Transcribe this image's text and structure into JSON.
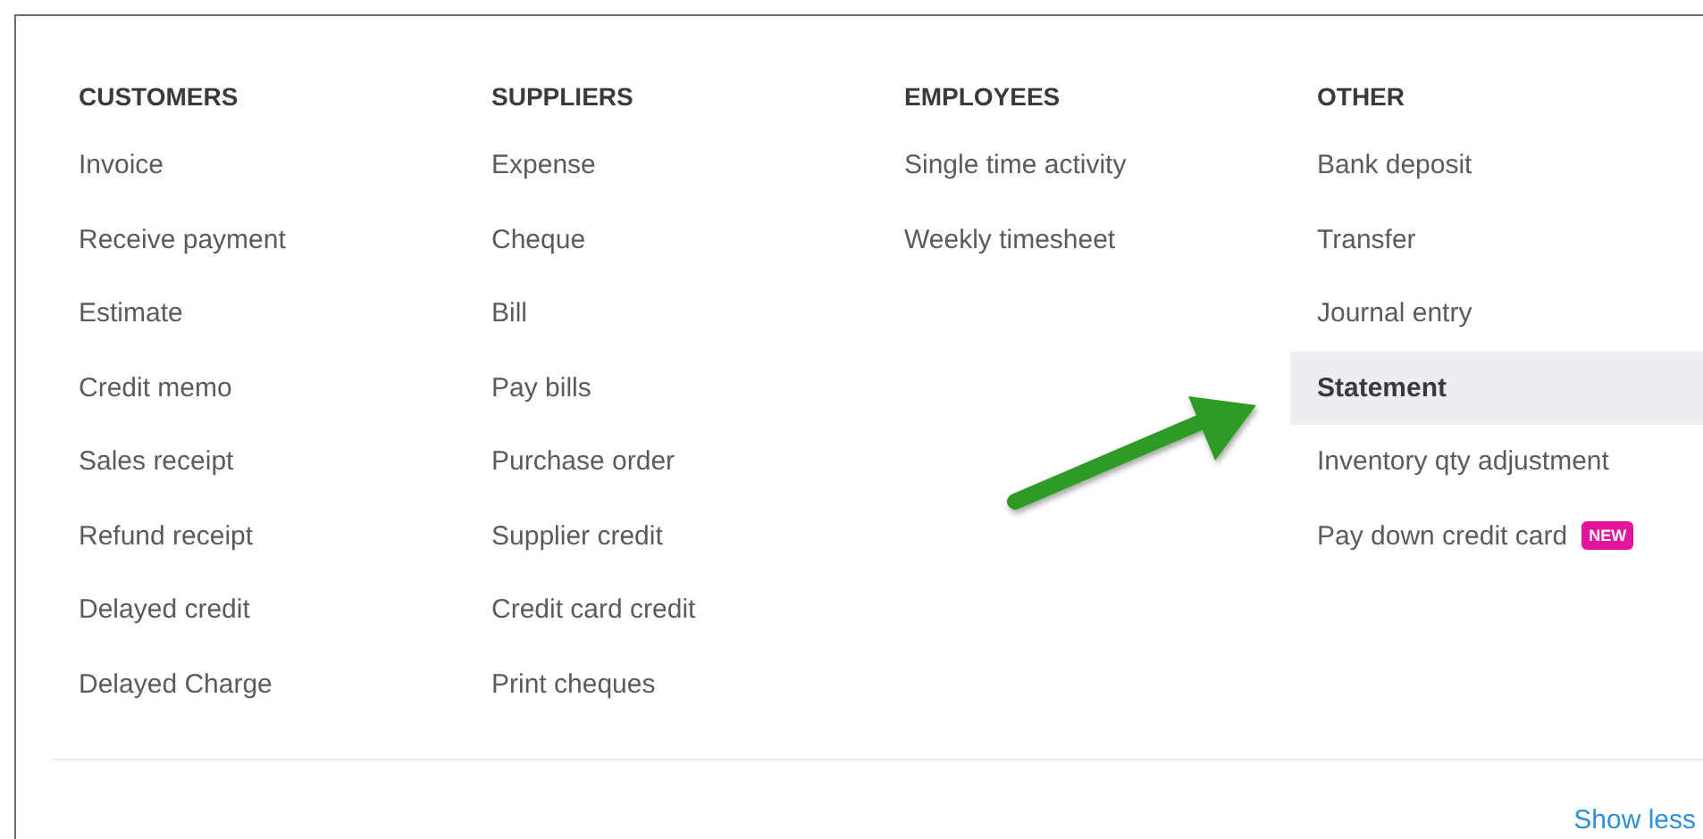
{
  "columns": [
    {
      "heading": "CUSTOMERS",
      "items": [
        {
          "label": "Invoice",
          "selected": false
        },
        {
          "label": "Receive payment",
          "selected": false
        },
        {
          "label": "Estimate",
          "selected": false
        },
        {
          "label": "Credit memo",
          "selected": false
        },
        {
          "label": "Sales receipt",
          "selected": false
        },
        {
          "label": "Refund receipt",
          "selected": false
        },
        {
          "label": "Delayed credit",
          "selected": false
        },
        {
          "label": "Delayed Charge",
          "selected": false
        }
      ]
    },
    {
      "heading": "SUPPLIERS",
      "items": [
        {
          "label": "Expense",
          "selected": false
        },
        {
          "label": "Cheque",
          "selected": false
        },
        {
          "label": "Bill",
          "selected": false
        },
        {
          "label": "Pay bills",
          "selected": false
        },
        {
          "label": "Purchase order",
          "selected": false
        },
        {
          "label": "Supplier credit",
          "selected": false
        },
        {
          "label": "Credit card credit",
          "selected": false
        },
        {
          "label": "Print cheques",
          "selected": false
        }
      ]
    },
    {
      "heading": "EMPLOYEES",
      "items": [
        {
          "label": "Single time activity",
          "selected": false
        },
        {
          "label": "Weekly timesheet",
          "selected": false
        }
      ]
    },
    {
      "heading": "OTHER",
      "items": [
        {
          "label": "Bank deposit",
          "selected": false
        },
        {
          "label": "Transfer",
          "selected": false
        },
        {
          "label": "Journal entry",
          "selected": false
        },
        {
          "label": "Statement",
          "selected": true
        },
        {
          "label": "Inventory qty adjustment",
          "selected": false
        },
        {
          "label": "Pay down credit card",
          "selected": false,
          "badge": "NEW"
        }
      ]
    }
  ],
  "footer": {
    "link": "Show less"
  }
}
